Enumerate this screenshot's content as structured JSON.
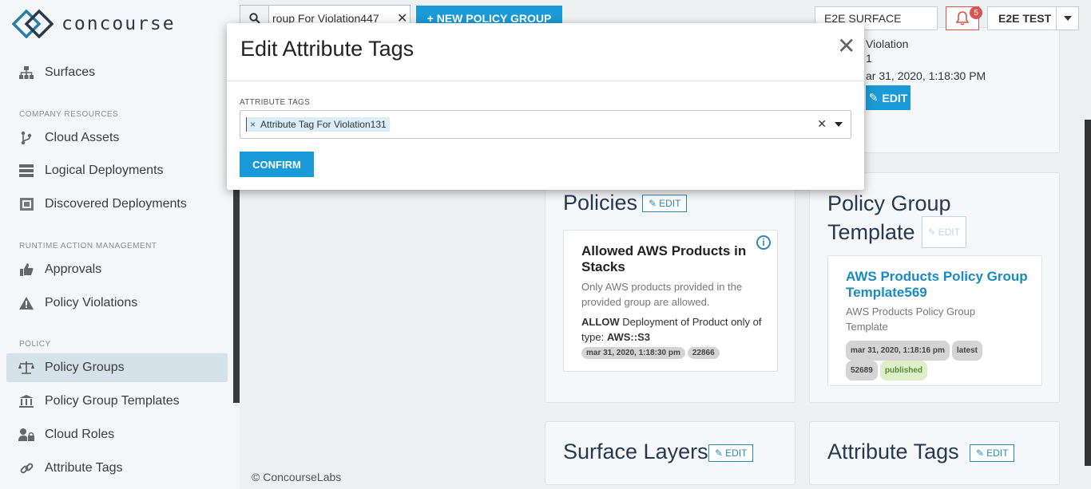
{
  "app": {
    "logo_text": "concourse"
  },
  "sidebar": {
    "top_item": {
      "label": "Surfaces",
      "icon": "sitemap-icon"
    },
    "sections": [
      {
        "label": "COMPANY RESOURCES"
      },
      {
        "label": "RUNTIME ACTION MANAGEMENT"
      },
      {
        "label": "POLICY"
      }
    ],
    "items": [
      {
        "label": "Cloud Assets",
        "icon": "branch-icon"
      },
      {
        "label": "Logical Deployments",
        "icon": "server-icon"
      },
      {
        "label": "Discovered Deployments",
        "icon": "scan-icon"
      },
      {
        "label": "Approvals",
        "icon": "thumbs-up-icon"
      },
      {
        "label": "Policy Violations",
        "icon": "warning-icon"
      },
      {
        "label": "Policy Groups",
        "icon": "balance-scale-icon"
      },
      {
        "label": "Policy Group Templates",
        "icon": "bank-icon"
      },
      {
        "label": "Cloud Roles",
        "icon": "user-lock-icon"
      },
      {
        "label": "Attribute Tags",
        "icon": "link-icon"
      }
    ],
    "active_item": "Policy Groups"
  },
  "topbar": {
    "search_value": "roup For Violation447",
    "new_policy_group": "+ NEW POLICY GROUP",
    "surface": "E2E SURFACE",
    "notification_count": "5",
    "user": "E2E TEST"
  },
  "background": {
    "top_card": {
      "line1": "Violation",
      "line2": "1",
      "timestamp": "ar 31, 2020, 1:18:30 PM",
      "edit": "EDIT"
    },
    "policies": {
      "title": "Policies",
      "edit": "EDIT",
      "card": {
        "name": "Allowed AWS Products in Stacks",
        "description": "Only AWS products provided in the provided group are allowed.",
        "rule_prefix": "ALLOW",
        "rule_text": "Deployment of Product only of type:",
        "rule_value": "AWS::S3",
        "chips": [
          "mar 31, 2020, 1:18:30 pm",
          "22866"
        ]
      }
    },
    "template": {
      "title_line1": "Policy Group",
      "title_line2": "Template",
      "edit": "EDIT",
      "card": {
        "name": "AWS Products Policy Group Template569",
        "description": "AWS Products Policy Group Template",
        "chips": [
          "mar 31, 2020, 1:18:16 pm",
          "latest",
          "52689",
          "published"
        ]
      }
    },
    "surface_layers": {
      "title": "Surface Layers",
      "edit": "EDIT"
    },
    "attribute_tags": {
      "title": "Attribute Tags",
      "edit": "EDIT"
    }
  },
  "footer": {
    "text": "© ConcourseLabs"
  },
  "modal": {
    "title": "Edit Attribute Tags",
    "field_label": "ATTRIBUTE TAGS",
    "selected_tag": "Attribute Tag For Violation131",
    "confirm": "CONFIRM"
  },
  "colors": {
    "primary": "#1a9ad6",
    "navy": "#233a51",
    "danger": "#d9534f"
  }
}
